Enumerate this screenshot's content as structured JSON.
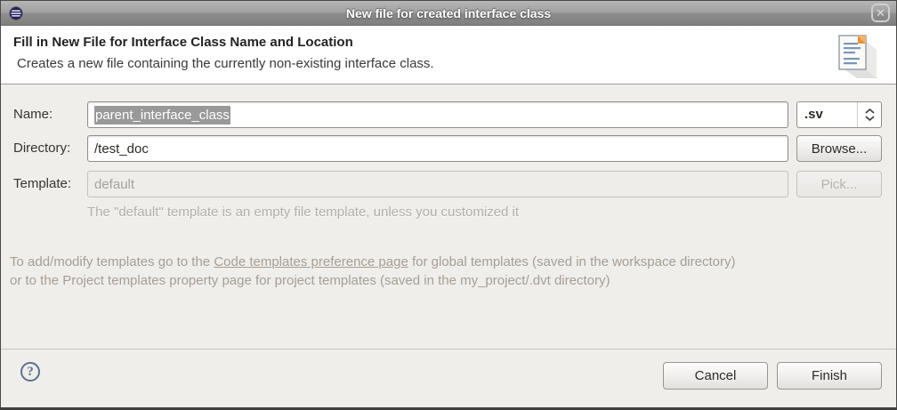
{
  "window": {
    "title": "New file for created interface class",
    "close_glyph": "✕"
  },
  "header": {
    "title": "Fill in New File for Interface Class Name and Location",
    "subtitle": "Creates a new file containing the currently non-existing interface class."
  },
  "form": {
    "name_label": "Name:",
    "name_value": "parent_interface_class",
    "extension_value": ".sv",
    "directory_label": "Directory:",
    "directory_value": "/test_doc",
    "browse_label": "Browse...",
    "template_label": "Template:",
    "template_value": "default",
    "pick_label": "Pick...",
    "template_note": "The \"default\" template is an empty file template, unless you customized it"
  },
  "info": {
    "part1": "To add/modify templates go to the ",
    "link": "Code templates preference page",
    "part2": " for global templates (saved in the workspace directory)",
    "part3": "or to the Project templates property page for project templates (saved in the my_project/.dvt directory)"
  },
  "footer": {
    "help_glyph": "?",
    "cancel_label": "Cancel",
    "finish_label": "Finish"
  },
  "colors": {
    "titlebar_top": "#b6b6b6",
    "titlebar_bottom": "#7f7f7f",
    "header_bg": "#ffffff",
    "body_bg": "#f0eeeb",
    "selection_bg": "#999999",
    "muted_text": "#a59e95",
    "help_accent": "#5d7090",
    "folded_corner": "#e8913c"
  }
}
